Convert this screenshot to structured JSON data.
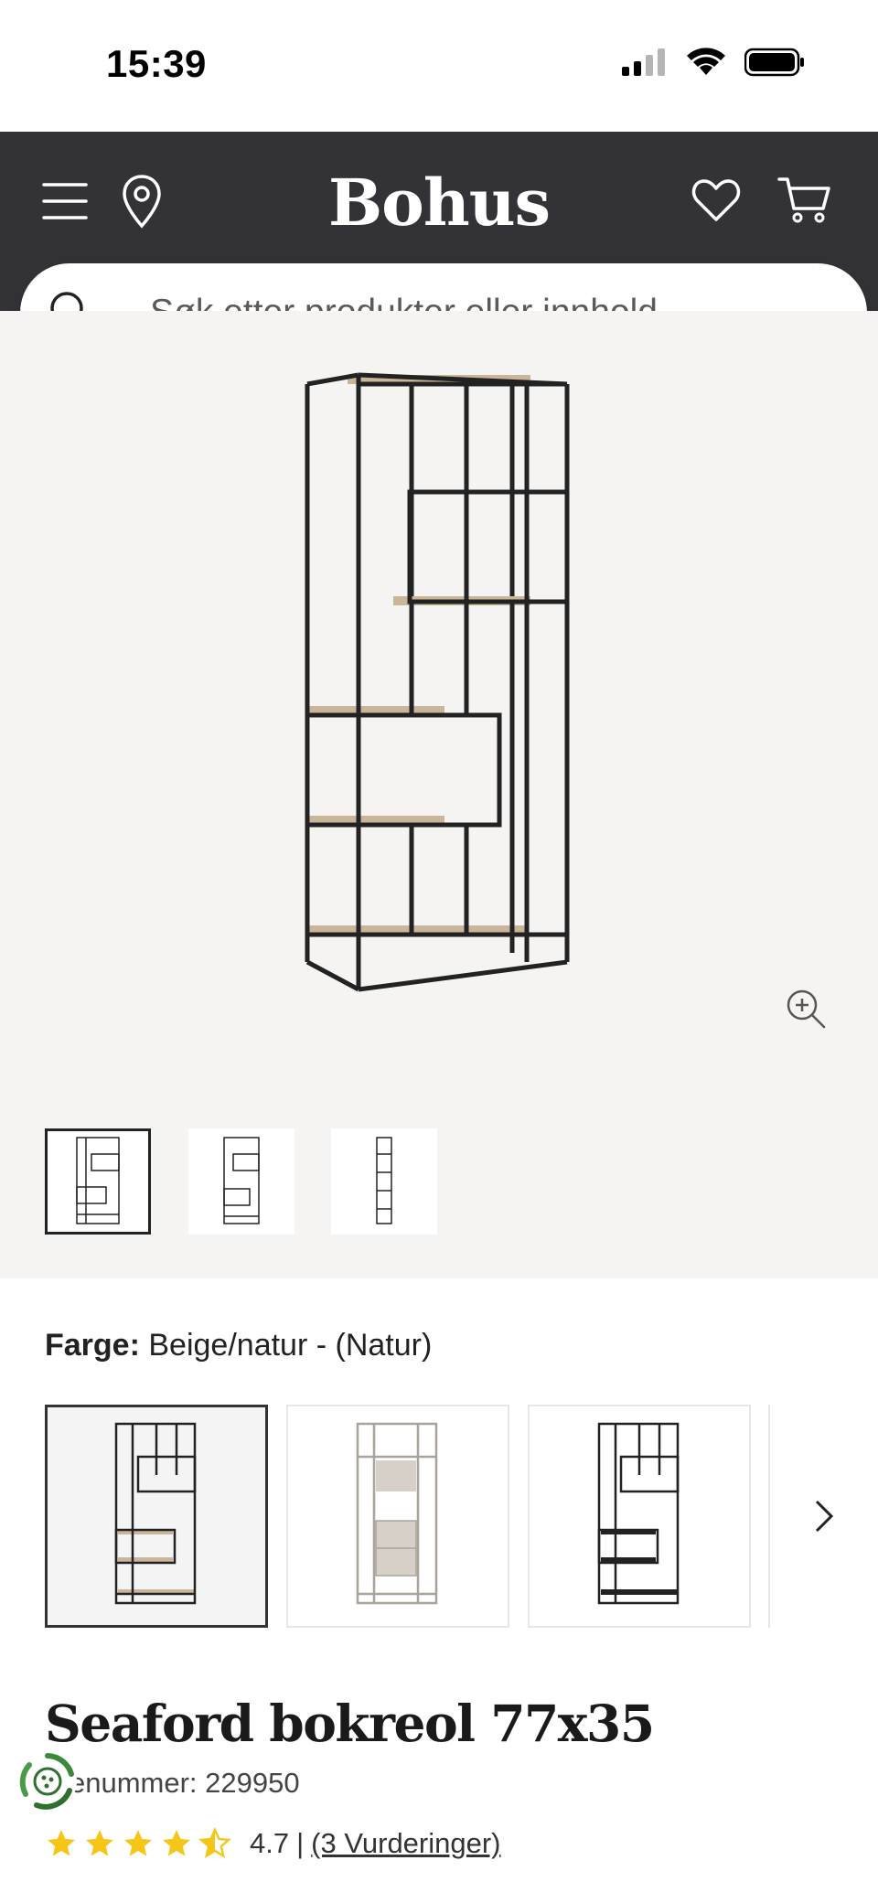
{
  "status_bar": {
    "time": "15:39",
    "icons": [
      "cellular-signal-icon",
      "wifi-icon",
      "battery-icon"
    ]
  },
  "header": {
    "logo": "Bohus",
    "left_icons": [
      "menu-icon",
      "location-pin-icon"
    ],
    "right_icons": [
      "heart-icon",
      "cart-icon"
    ],
    "background_color": "#333236"
  },
  "search": {
    "placeholder": "Søk etter produkter eller innhold ..."
  },
  "gallery": {
    "zoom_icon": "zoom-in-icon",
    "thumbnails": [
      {
        "view": "front",
        "selected": true
      },
      {
        "view": "angle",
        "selected": false
      },
      {
        "view": "side",
        "selected": false
      }
    ]
  },
  "color": {
    "label": "Farge:",
    "value": "Beige/natur - (Natur)",
    "swatches": [
      {
        "name": "natur",
        "selected": true
      },
      {
        "name": "beige",
        "selected": false
      },
      {
        "name": "black",
        "selected": false
      }
    ],
    "next_icon": "chevron-right-icon"
  },
  "product": {
    "title": "Seaford bokreol 77x35",
    "item_number": "enummer: 229950",
    "rating": 4.7,
    "rating_text": "4.7",
    "rating_separator": "|",
    "reviews_link": "(3 Vurderinger)",
    "star_color": "#f5c518"
  }
}
